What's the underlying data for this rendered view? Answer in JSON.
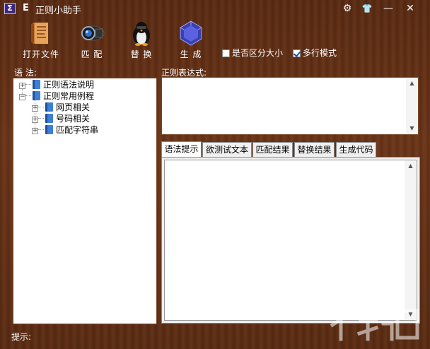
{
  "window": {
    "logo_char": "Σ",
    "badge": "E",
    "title": "正则小助手"
  },
  "titlebar_buttons": [
    {
      "name": "settings",
      "glyph": "⚙"
    },
    {
      "name": "skin",
      "glyph": "👕"
    },
    {
      "name": "minimize",
      "glyph": "—"
    },
    {
      "name": "close",
      "glyph": "✕"
    }
  ],
  "toolbar": {
    "open_file": "打开文件",
    "match": "匹 配",
    "replace": "替 换",
    "generate": "生 成",
    "case_sensitive": {
      "label": "是否区分大小",
      "checked": false
    },
    "multiline": {
      "label": "多行模式",
      "checked": true
    }
  },
  "labels": {
    "syntax": "语 法:",
    "regex": "正则表达式:",
    "hint": "提示:"
  },
  "tree": {
    "nodes": [
      {
        "label": "正则语法说明",
        "expander": "+"
      },
      {
        "label": "正则常用例程",
        "expander": "−"
      },
      {
        "label": "网页相关",
        "expander": "+"
      },
      {
        "label": "号码相关",
        "expander": "+"
      },
      {
        "label": "匹配字符串",
        "expander": "+"
      }
    ]
  },
  "regex_input": {
    "value": ""
  },
  "tabs": [
    {
      "label": "语法提示",
      "active": true
    },
    {
      "label": "欲测试文本",
      "active": false
    },
    {
      "label": "匹配结果",
      "active": false
    },
    {
      "label": "替换结果",
      "active": false
    },
    {
      "label": "生成代码",
      "active": false
    }
  ],
  "tab_content": {
    "value": ""
  },
  "icons": {
    "open_file": "book-icon",
    "match": "lens-icon",
    "replace": "penguin-icon",
    "generate": "dice-icon"
  },
  "colors": {
    "frame": "#5a2a12",
    "title_text": "#ffffff"
  }
}
